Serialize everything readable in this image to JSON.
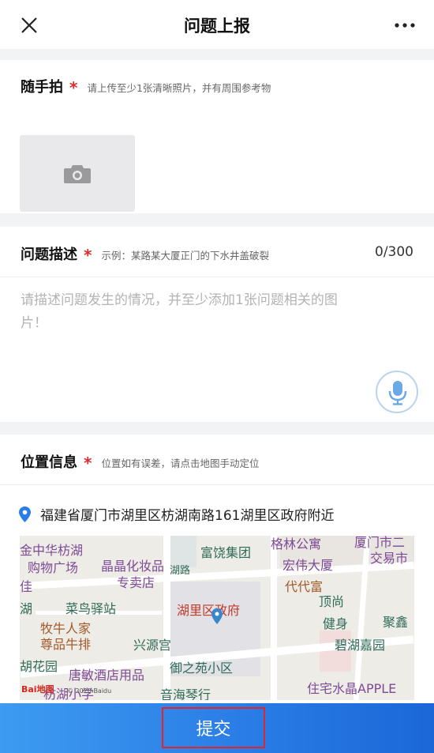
{
  "header": {
    "title": "问题上报",
    "close_icon": "close-icon",
    "more_icon": "more-icon"
  },
  "photo": {
    "title": "随手拍",
    "required_mark": "*",
    "hint": "请上传至少1张清晰照片，并有周围参考物",
    "add_icon": "camera-icon"
  },
  "description": {
    "title": "问题描述",
    "required_mark": "*",
    "hint": "示例：某路某大厦正门的下水井盖破裂",
    "counter": "0/300",
    "placeholder": "请描述问题发生的情况，并至少添加1张问题相关的图片！",
    "voice_icon": "microphone-icon"
  },
  "location": {
    "title": "位置信息",
    "required_mark": "*",
    "hint": "位置如有误差，请点击地图手动定位",
    "address": "福建省厦门市湖里区枋湖南路161湖里区政府附近",
    "address_icon": "location-pin-icon",
    "map": {
      "labels": {
        "l1": "金中华枋湖",
        "l2": "购物广场",
        "l3": "佳",
        "l4": "湖",
        "l5": "晶晶化妆品",
        "l6": "专卖店",
        "l7": "富饶集团",
        "l8": "格林公寓",
        "l9": "厦门市二",
        "l10": "交易市",
        "l11": "宏伟大厦",
        "l12": "代代富",
        "l13": "菜鸟驿站",
        "l14": "湖里区政府",
        "l15": "牧牛人家",
        "l16": "尊品牛排",
        "l17": "兴源宫",
        "l18": "顶尚",
        "l19": "健身",
        "l20": "聚鑫",
        "l21": "碧湖嘉园",
        "l22": "胡花园",
        "l23": "唐敏酒店用品",
        "l24": "御之苑小区",
        "l25": "住宅水晶APPLE",
        "l26": "枋湖小学",
        "l27": "音海琴行",
        "l28": "湖路"
      },
      "logo": "Bai地图",
      "copyright": "© 2020 Baidu"
    }
  },
  "footer": {
    "submit_label": "提交"
  }
}
